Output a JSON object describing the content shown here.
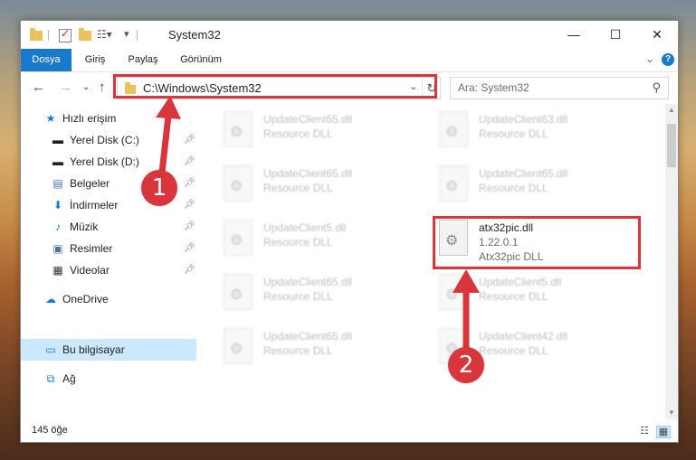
{
  "window": {
    "title": "System32"
  },
  "ribbon": {
    "tabs": [
      "Dosya",
      "Giriş",
      "Paylaş",
      "Görünüm"
    ],
    "help": "?"
  },
  "address": {
    "path": "C:\\Windows\\System32",
    "refresh": "↻"
  },
  "search": {
    "placeholder": "Ara: System32"
  },
  "nav": {
    "quick_access": "Hızlı erişim",
    "items": [
      {
        "label": "Yerel Disk (C:)",
        "icon": "drive-icon"
      },
      {
        "label": "Yerel Disk (D:)",
        "icon": "drive-icon"
      },
      {
        "label": "Belgeler",
        "icon": "documents-icon"
      },
      {
        "label": "İndirmeler",
        "icon": "downloads-icon"
      },
      {
        "label": "Müzik",
        "icon": "music-icon"
      },
      {
        "label": "Resimler",
        "icon": "pictures-icon"
      },
      {
        "label": "Videolar",
        "icon": "videos-icon"
      }
    ],
    "onedrive": "OneDrive",
    "this_pc": "Bu bilgisayar",
    "network": "Ağ"
  },
  "files": [
    {
      "name": "UpdateClient65.dll",
      "sub": "Resource DLL"
    },
    {
      "name": "UpdateClient63.dll",
      "sub": "Resource DLL"
    },
    {
      "name": "UpdateClient65.dll",
      "sub": "Resource DLL"
    },
    {
      "name": "UpdateClient65.dll",
      "sub": "Resource DLL"
    },
    {
      "name": "UpdateClient5.dll",
      "sub": "Resource DLL"
    },
    {
      "name": "atx32pic.dll",
      "version": "1.22.0.1",
      "sub": "Atx32pic DLL"
    },
    {
      "name": "UpdateClient65.dll",
      "sub": "Resource DLL"
    },
    {
      "name": "UpdateClient5.dll",
      "sub": "Resource DLL"
    },
    {
      "name": "UpdateClient65.dll",
      "sub": "Resource DLL"
    },
    {
      "name": "UpdateClient42.dll",
      "sub": "Resource DLL"
    }
  ],
  "status": {
    "count": "145 öğe"
  },
  "annotations": {
    "step1": "1",
    "step2": "2",
    "color": "#d8363c"
  }
}
